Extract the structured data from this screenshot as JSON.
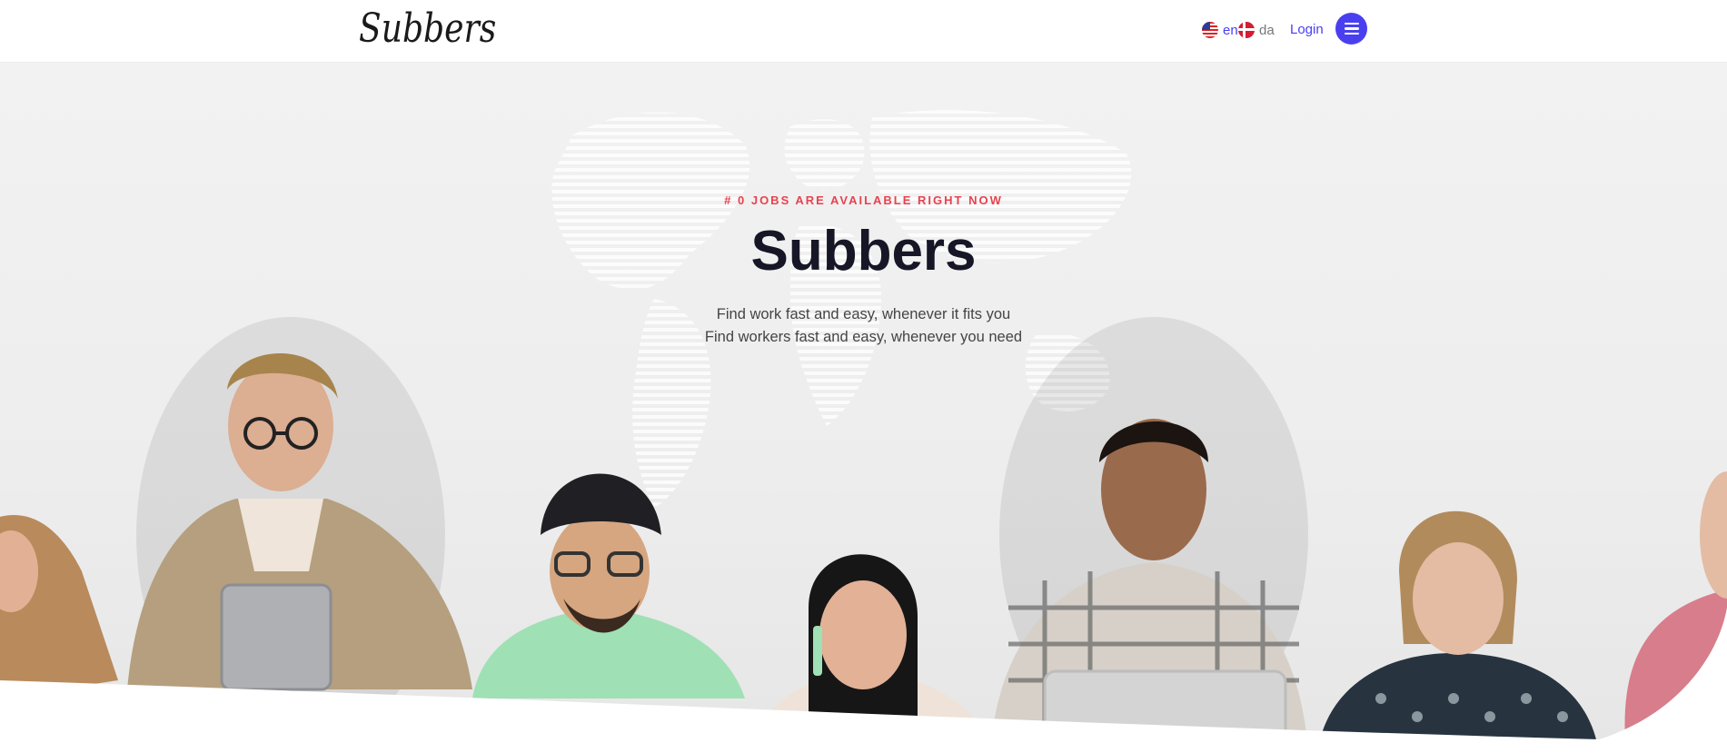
{
  "header": {
    "logo": "Subbers",
    "languages": [
      {
        "code": "en",
        "flag": "us-flag-icon",
        "active": true
      },
      {
        "code": "da",
        "flag": "dk-flag-icon",
        "active": false
      }
    ],
    "login_label": "Login",
    "menu_icon": "hamburger-menu-icon"
  },
  "hero": {
    "tagline": "# 0 JOBS ARE AVAILABLE RIGHT NOW",
    "title": "Subbers",
    "subtitle_1": "Find work fast and easy, whenever it fits you",
    "subtitle_2": "Find workers fast and easy, whenever you need"
  },
  "colors": {
    "accent": "#4a3ff0",
    "tagline": "#e8424f",
    "title": "#161627",
    "hero_bg": "#f0f0f0"
  }
}
